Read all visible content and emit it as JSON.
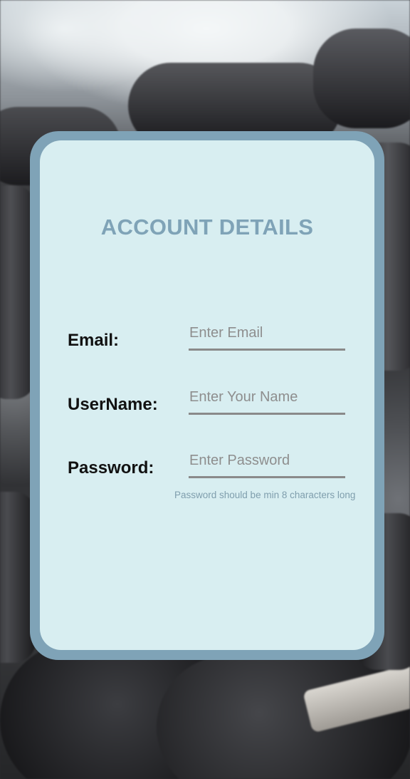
{
  "form": {
    "title": "ACCOUNT DETAILS",
    "fields": {
      "email": {
        "label": "Email:",
        "placeholder": "Enter Email",
        "value": ""
      },
      "username": {
        "label": "UserName:",
        "placeholder": "Enter Your Name",
        "value": ""
      },
      "password": {
        "label": "Password:",
        "placeholder": "Enter Password",
        "value": "",
        "hint": "Password should be min 8 characters long"
      }
    }
  },
  "colors": {
    "accent": "#7fa3b7",
    "card_background": "#d8eef1",
    "label_text": "#111111",
    "placeholder_text": "#8e8e8e",
    "underline": "#8a8a8a",
    "hint_text": "#7f9ead"
  }
}
